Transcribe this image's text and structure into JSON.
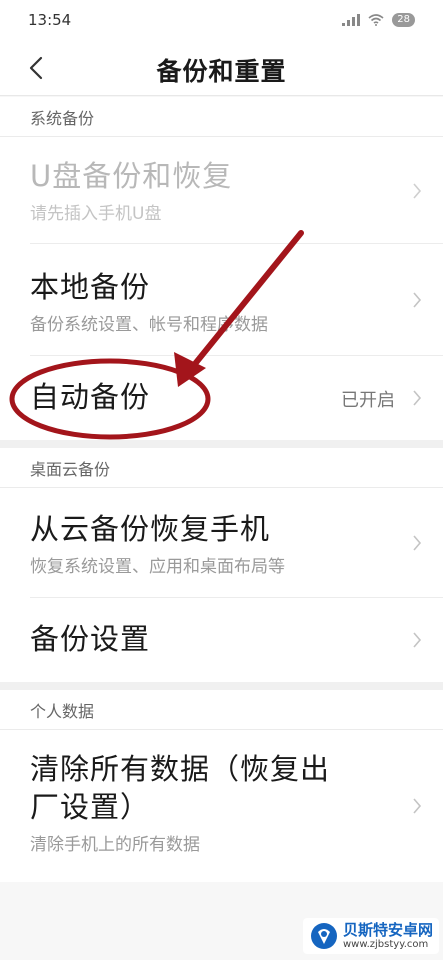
{
  "status": {
    "time": "13:54",
    "battery": "28"
  },
  "header": {
    "title": "备份和重置"
  },
  "sections": [
    {
      "header": "系统备份",
      "items": [
        {
          "title": "U盘备份和恢复",
          "subtitle": "请先插入手机U盘"
        },
        {
          "title": "本地备份",
          "subtitle": "备份系统设置、帐号和程序数据"
        },
        {
          "title": "自动备份",
          "value": "已开启"
        }
      ]
    },
    {
      "header": "桌面云备份",
      "items": [
        {
          "title": "从云备份恢复手机",
          "subtitle": "恢复系统设置、应用和桌面布局等"
        },
        {
          "title": "备份设置"
        }
      ]
    },
    {
      "header": "个人数据",
      "items": [
        {
          "title_line1": "清除所有数据（恢复出",
          "title_line2": "厂设置）",
          "subtitle": "清除手机上的所有数据"
        }
      ]
    }
  ],
  "watermark": {
    "name": "贝斯特安卓网",
    "url": "www.zjbstyy.com"
  },
  "colors": {
    "annotation": "#a3151b",
    "background": "#f7f7f7",
    "watermark": "#1565c0"
  }
}
